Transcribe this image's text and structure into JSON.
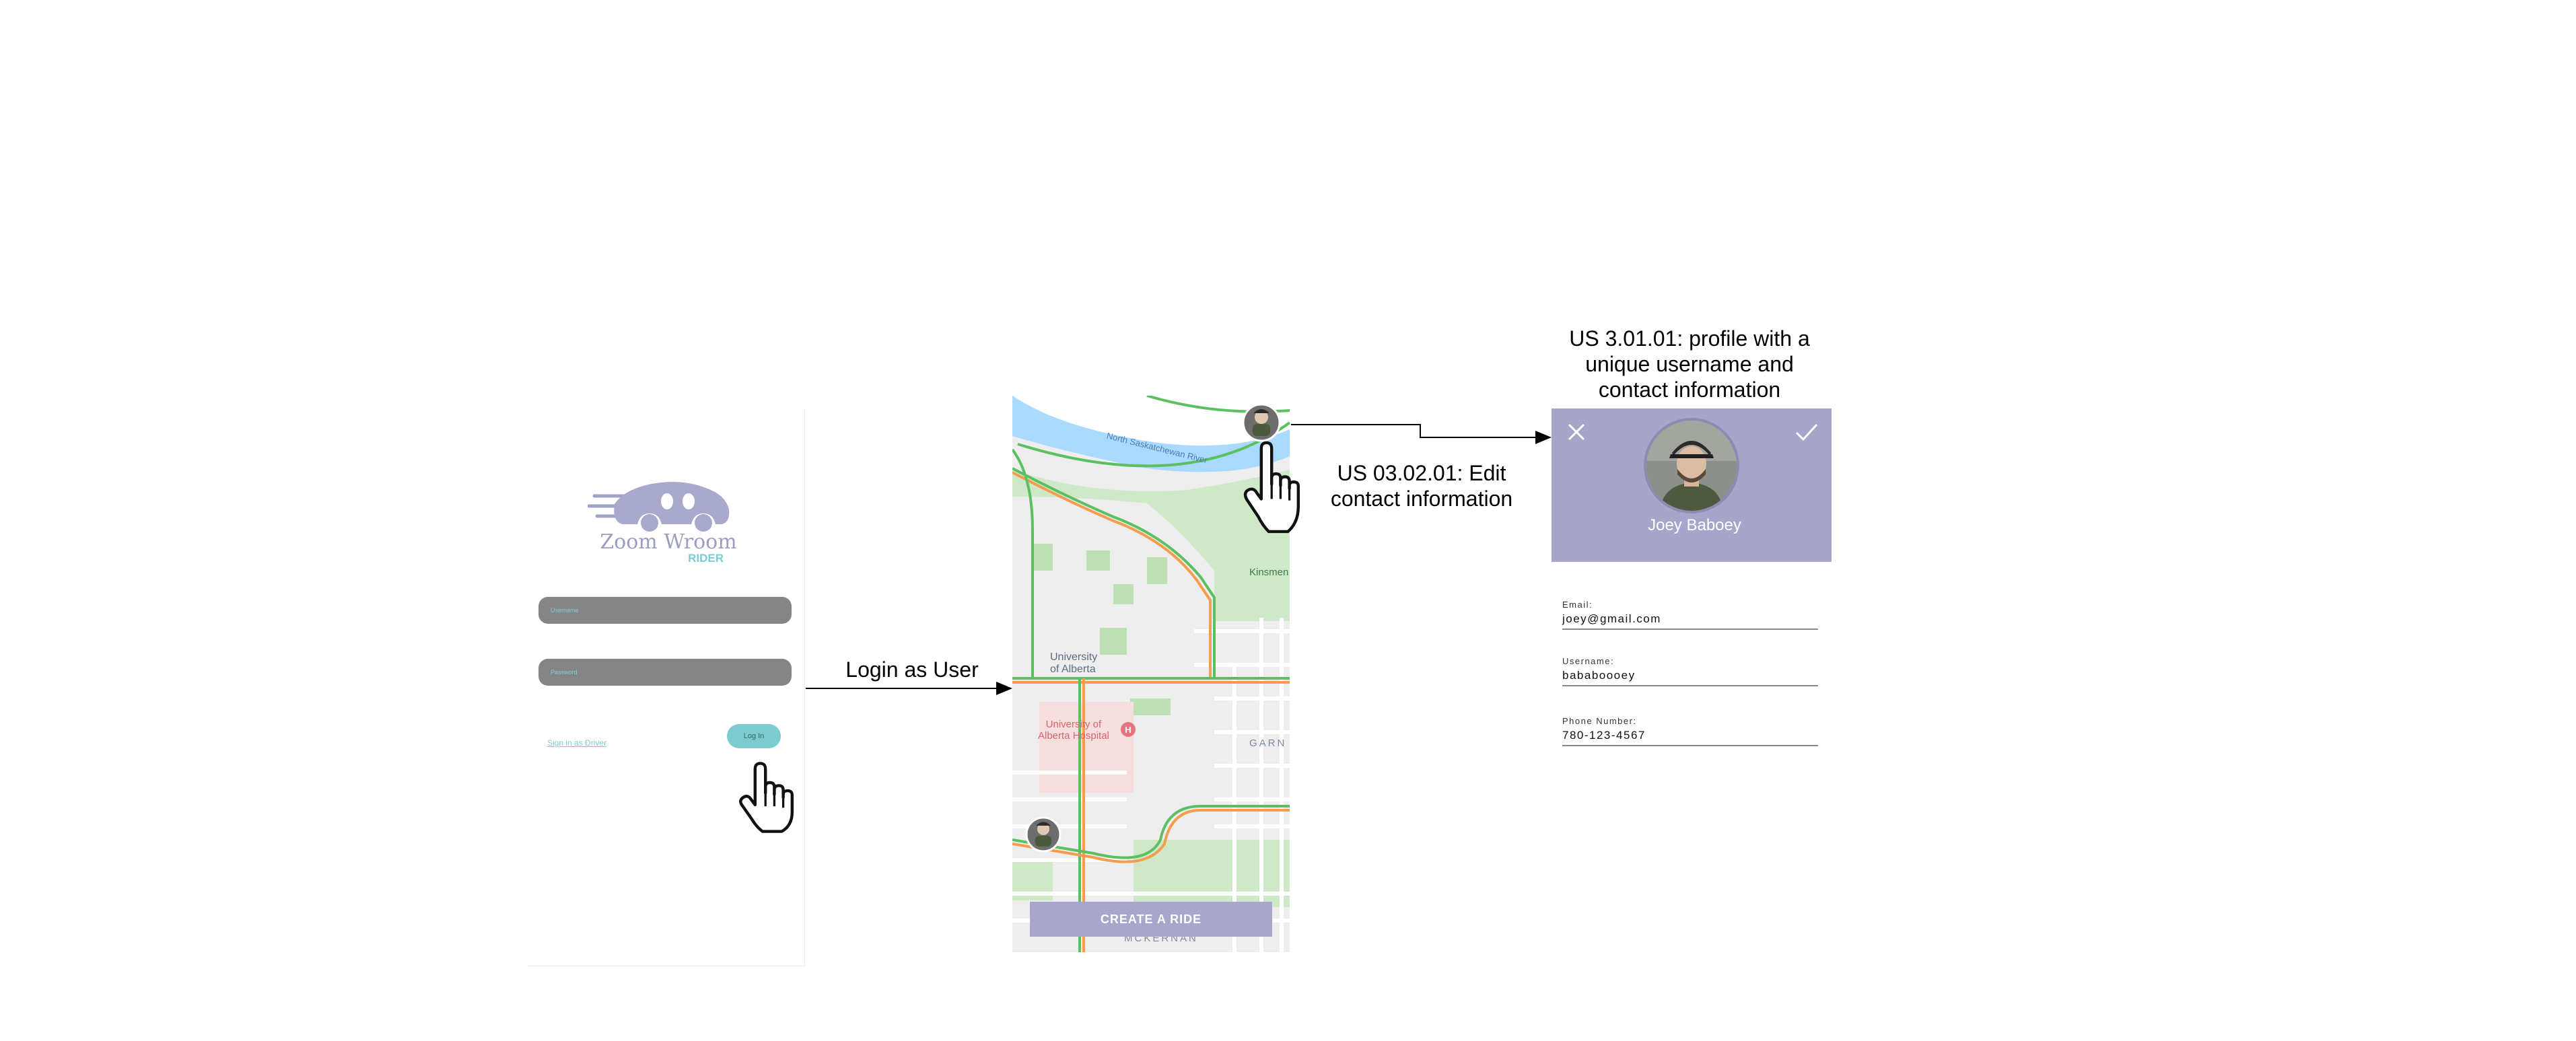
{
  "login": {
    "logo_text_top": "Zoom Wroom",
    "logo_text_bottom": "RIDER",
    "username_placeholder": "Username",
    "password_placeholder": "Password",
    "sign_in_driver": "Sign in as Driver",
    "login_button": "Log In"
  },
  "arrows": {
    "login_label": "Login as User",
    "edit_label": "US 03.02.01: Edit\ncontact information",
    "profile_label": "US 3.01.01: profile with a\nunique username and\ncontact information"
  },
  "map": {
    "labels": {
      "river": "North Saskatchewan River",
      "university": "University\nof Alberta",
      "hospital": "University of\nAlberta Hospital",
      "kinsmen": "Kinsmen",
      "garneau": "GARN",
      "mckernan": "MCKERNAN"
    },
    "create_ride": "CREATE A RIDE"
  },
  "profile": {
    "name": "Joey Baboey",
    "fields": [
      {
        "label": "Email:",
        "value": "joey@gmail.com"
      },
      {
        "label": "Username:",
        "value": "bababoooey"
      },
      {
        "label": "Phone Number:",
        "value": "780-123-4567"
      }
    ]
  },
  "colors": {
    "accent_purple": "#a7a6ca",
    "accent_teal": "#7ccbcf"
  },
  "icons": [
    "hand-pointer-icon",
    "close-icon",
    "check-icon",
    "hospital-pin-icon"
  ]
}
